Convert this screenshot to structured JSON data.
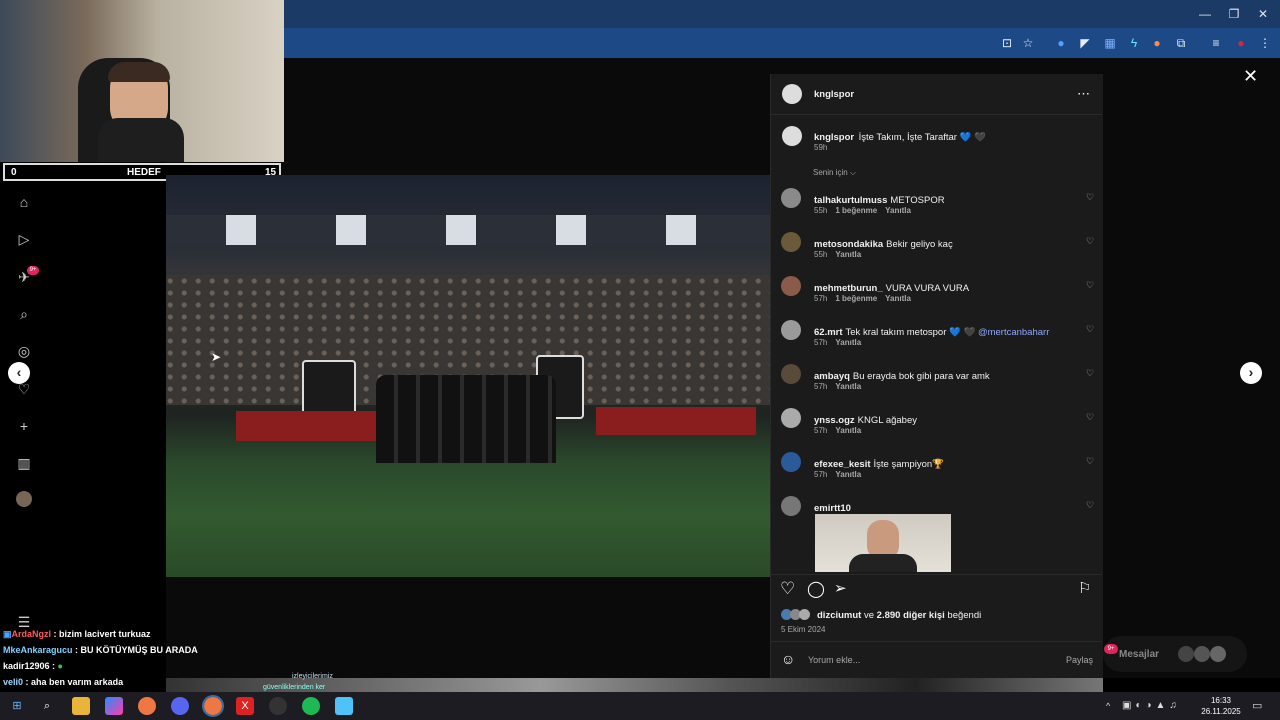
{
  "overlay": {
    "goal": {
      "left": "0",
      "label": "HEDEF",
      "right": "15"
    },
    "chat": [
      {
        "user": "ArdaNgzl",
        "text": " : bizim lacivert turkuaz",
        "color": "#ff5a5a"
      },
      {
        "user": "MkeAnkaragucu",
        "text": " : BU KÖTÜYMÜŞ BU ARADA",
        "color": "#7fd1ff"
      },
      {
        "user": "kadir12906",
        "text": " : ",
        "color": "#ffffff"
      },
      {
        "user": "veli0",
        "text": " : aha ben varım arkada",
        "color": "#9ad7ff"
      }
    ]
  },
  "sidebar": {
    "notification_badge": "9+",
    "icons": [
      "home-icon",
      "reels-icon",
      "messages-icon",
      "search-icon",
      "explore-icon",
      "notifications-icon",
      "create-icon",
      "dashboard-icon",
      "profile-avatar"
    ]
  },
  "post": {
    "author": "knglspor",
    "caption_user": "knglspor",
    "caption_text": "İşte Takım, İşte Taraftar 💙 🖤",
    "caption_time": "59h",
    "sort_label": "Senin için ⌵",
    "comments": [
      {
        "user": "talhakurtulmuss",
        "text": "METOSPOR",
        "time": "55h",
        "likes": "1 beğenme",
        "reply": "Yanıtla"
      },
      {
        "user": "metosondakika",
        "text": "Bekir geliyo kaç",
        "time": "55h",
        "likes": "",
        "reply": "Yanıtla"
      },
      {
        "user": "mehmetburun_",
        "text": "VURA VURA VURA",
        "time": "57h",
        "likes": "1 beğenme",
        "reply": "Yanıtla"
      },
      {
        "user": "62.mrt",
        "text": "Tek kral takım metospor 💙 🖤 ",
        "mention": "@mertcanbaharr",
        "time": "57h",
        "likes": "",
        "reply": "Yanıtla"
      },
      {
        "user": "ambayq",
        "text": "Bu erayda bok gibi para var amk",
        "time": "57h",
        "likes": "",
        "reply": "Yanıtla"
      },
      {
        "user": "ynss.ogz",
        "text": "KNGL ağabey",
        "time": "57h",
        "likes": "",
        "reply": "Yanıtla"
      },
      {
        "user": "efexee_kesit",
        "text": "İşte şampiyon🏆",
        "time": "57h",
        "likes": "",
        "reply": "Yanıtla"
      },
      {
        "user": "emirtt10",
        "text": "",
        "time": "",
        "likes": "",
        "reply": ""
      }
    ],
    "liked_by_user": "dizciumut",
    "liked_by_mid": " ve ",
    "liked_by_count": "2.890 diğer kişi",
    "liked_by_tail": " beğendi",
    "date": "5 Ekim 2024",
    "comment_placeholder": "Yorum ekle...",
    "share_label": "Paylaş"
  },
  "messages_pill": {
    "label": "Mesajlar",
    "badge": "9+"
  },
  "banner_text": [
    "izleyicilerimiz",
    "güvenliklerinden ker"
  ],
  "taskbar": {
    "time": "16:33",
    "date": "26.11.2025"
  },
  "colors": {
    "accent_blue": "#1d4a86",
    "mention": "#8fa8ff"
  }
}
